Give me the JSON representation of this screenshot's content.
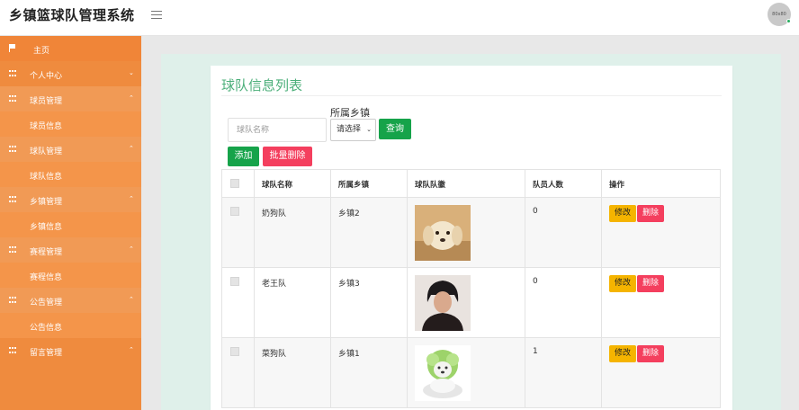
{
  "header": {
    "app_title": "乡镇篮球队管理系统",
    "avatar_text": "80x80"
  },
  "sidebar": {
    "items": [
      {
        "label": "主页",
        "type": "home"
      },
      {
        "label": "个人中心",
        "type": "group",
        "arrow": "⌄"
      },
      {
        "label": "球员管理",
        "type": "group",
        "arrow": "⌃"
      },
      {
        "label": "球员信息",
        "type": "sub"
      },
      {
        "label": "球队管理",
        "type": "group",
        "arrow": "⌃"
      },
      {
        "label": "球队信息",
        "type": "sub"
      },
      {
        "label": "乡镇管理",
        "type": "group",
        "arrow": "⌃"
      },
      {
        "label": "乡镇信息",
        "type": "sub"
      },
      {
        "label": "赛程管理",
        "type": "group",
        "arrow": "⌃"
      },
      {
        "label": "赛程信息",
        "type": "sub"
      },
      {
        "label": "公告管理",
        "type": "group",
        "arrow": "⌃"
      },
      {
        "label": "公告信息",
        "type": "sub"
      },
      {
        "label": "留言管理",
        "type": "group",
        "arrow": "⌃"
      }
    ]
  },
  "main": {
    "title": "球队信息列表",
    "filter": {
      "town_label": "所属乡镇",
      "name_placeholder": "球队名称",
      "town_selected": "请选择",
      "query_label": "查询"
    },
    "actions": {
      "add_label": "添加",
      "batch_delete_label": "批量删除"
    },
    "table": {
      "headers": [
        "球队名称",
        "所属乡镇",
        "球队队徽",
        "队员人数",
        "操作"
      ],
      "rows": [
        {
          "name": "奶狗队",
          "town": "乡镇2",
          "logo": "puppy-logo",
          "count": "0",
          "edit": "修改",
          "delete": "删除"
        },
        {
          "name": "老王队",
          "town": "乡镇3",
          "logo": "portrait-logo",
          "count": "0",
          "edit": "修改",
          "delete": "删除"
        },
        {
          "name": "菜狗队",
          "town": "乡镇1",
          "logo": "cabbage-dog-logo",
          "count": "1",
          "edit": "修改",
          "delete": "删除"
        }
      ]
    }
  },
  "colors": {
    "sidebar": "#ef8b3e",
    "title_green": "#4caf7a",
    "primary_green": "#16a34a",
    "danger": "#f43f5e",
    "warning": "#f5b400"
  }
}
